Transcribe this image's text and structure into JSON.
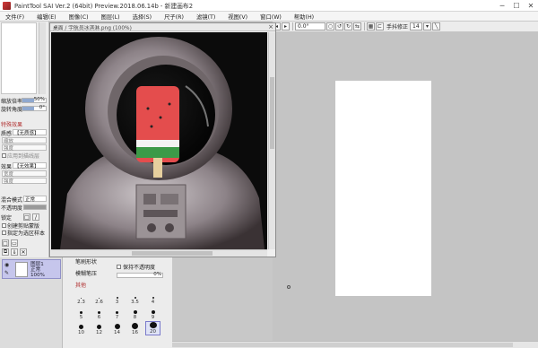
{
  "window": {
    "title": "PaintTool SAI Ver.2 (64bit) Preview.2018.06.14b - 新建画布2",
    "minimize": "─",
    "maximize": "☐",
    "close": "✕"
  },
  "menu": [
    "文件(F)",
    "编辑(E)",
    "图像(C)",
    "图层(L)",
    "选择(S)",
    "尺子(R)",
    "滤镜(T)",
    "视图(V)",
    "窗口(W)",
    "帮助(H)"
  ],
  "toolbar": {
    "angle": "0.0°",
    "stabilizer_label": "手抖修正",
    "stabilizer_value": "14"
  },
  "left_panel": {
    "zoom_label": "缩放倍率",
    "zoom_value": "50%",
    "angle_label": "旋转角度",
    "angle_value": "0°",
    "special_effects": "特殊效果",
    "texture_label": "质感",
    "texture_value": "【无质感】",
    "scale_label": "缩放",
    "strength_label": "强度",
    "dither": "应用到描线层",
    "effect_label": "效果",
    "effect_value": "【无效果】",
    "effect_width": "宽度",
    "effect_strength": "强度",
    "blend_label": "混合模式",
    "blend_value": "正常",
    "opacity_label": "不透明度",
    "lock_label": "锁定",
    "clip_label": "创建剪贴蒙版",
    "select_source_label": "指定为选区样本"
  },
  "image_window": {
    "title": "桌面 / 宇航员冰淇淋.png (100%)"
  },
  "layers": {
    "name": "图层1",
    "mode": "正常",
    "opacity": "100%"
  },
  "brush": {
    "blur_label": "模糊笔压",
    "blur_value": "0%",
    "keep_opacity": "保持不透明度",
    "other": "其他",
    "row_top_label": "笔刷形状",
    "sizes": [
      "2.3",
      "2.6",
      "3",
      "3.5",
      "4",
      "5",
      "6",
      "7",
      "8",
      "9",
      "10",
      "12",
      "14",
      "16",
      "20"
    ],
    "selected": "20"
  }
}
